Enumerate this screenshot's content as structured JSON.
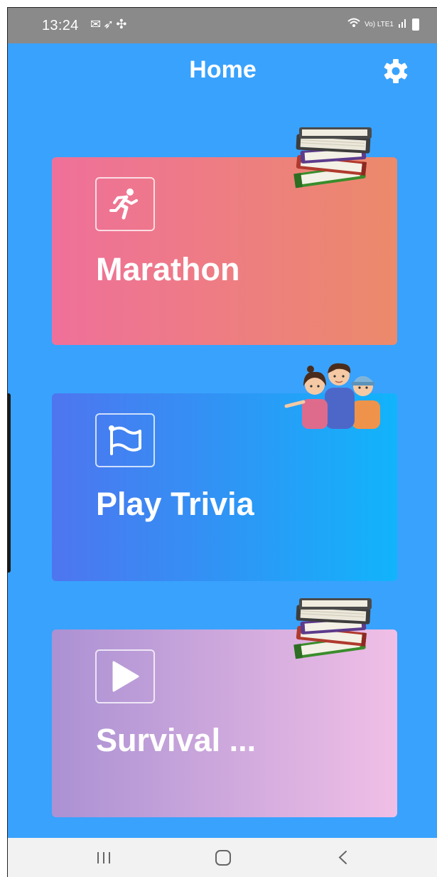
{
  "status_bar": {
    "time": "13:24",
    "notification_icons": [
      "mail-icon",
      "bird-icon",
      "fan-icon"
    ],
    "network_label": "Vo) LTE1",
    "right_icons": [
      "wifi-icon",
      "signal-icon",
      "battery-icon"
    ]
  },
  "header": {
    "title": "Home",
    "settings_icon": "gear-icon"
  },
  "modes": [
    {
      "label": "Marathon",
      "icon": "running-person-icon",
      "decoration": "books-icon",
      "gradient": [
        "#ef709a",
        "#ec8a6b"
      ]
    },
    {
      "label": "Play Trivia",
      "icon": "flag-icon",
      "decoration": "people-group-icon",
      "gradient": [
        "#4e75ef",
        "#11b4fb"
      ]
    },
    {
      "label": "Survival ...",
      "icon": "play-icon",
      "decoration": "books-icon",
      "gradient": [
        "#ab91d3",
        "#f0bfe6"
      ]
    }
  ],
  "colors": {
    "background": "#39a2fd",
    "status_bar": "#8a8a8a",
    "nav_bar": "#f2f2f2"
  },
  "nav_bar": {
    "buttons": [
      "recent-apps-icon",
      "home-icon",
      "back-icon"
    ]
  }
}
